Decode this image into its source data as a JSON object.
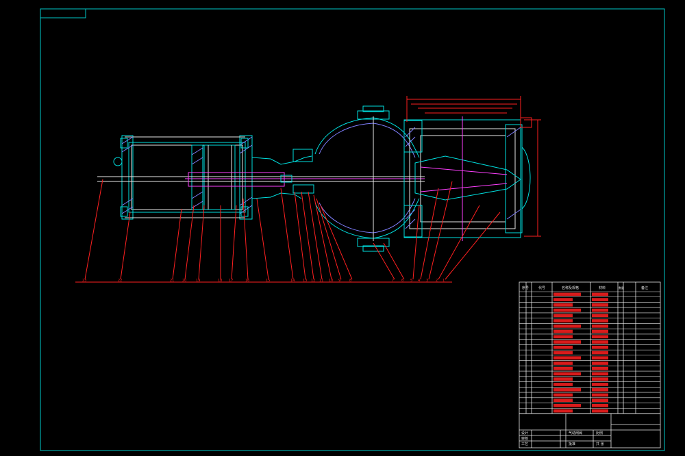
{
  "colors": {
    "background": "#000000",
    "frame": "#00c8c8",
    "part_outline": "#00e0e0",
    "hatch": "#8080ff",
    "white_line": "#e8e8e8",
    "leader": "#ff2020",
    "center_line": "#ff40ff",
    "text": "#ff2020",
    "title_text": "#e8e8e8"
  },
  "balloons_bottom": [
    "23",
    "22",
    "21",
    "20",
    "19",
    "18",
    "17",
    "16",
    "15",
    "14",
    "13",
    "12",
    "11",
    "10",
    "9",
    "8",
    "7",
    "6",
    "5",
    "4",
    "3",
    "2",
    "1"
  ],
  "balloons_row": [
    "23",
    "22",
    "21",
    "20",
    "19",
    "18",
    "17",
    "16",
    "15",
    "14",
    "13",
    "12",
    "11",
    "10",
    "9",
    "8",
    "7",
    "6",
    "5",
    "4",
    "3",
    "2",
    "1"
  ],
  "parts_list_header": {
    "no": "序号",
    "code": "代号",
    "name": "名称及规格",
    "qty": "数量",
    "material": "材料",
    "note": "备注"
  },
  "parts_list_rows": 23,
  "title_block": {
    "design": "设计",
    "check": "审核",
    "process": "工艺",
    "approve": "批准",
    "scale": "比例",
    "sheet": "共 张",
    "drawing_title": "气动闸阀"
  }
}
